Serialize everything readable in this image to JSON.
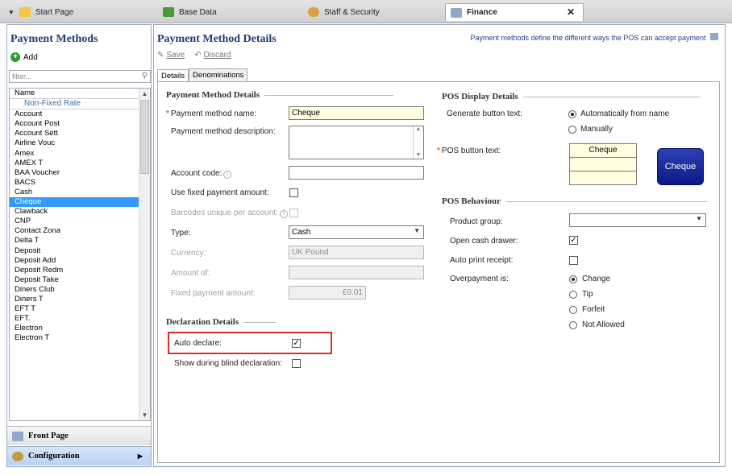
{
  "tabs": [
    {
      "label": "Start Page"
    },
    {
      "label": "Base Data"
    },
    {
      "label": "Staff & Security"
    },
    {
      "label": "Finance"
    }
  ],
  "left": {
    "title": "Payment Methods",
    "add_label": "Add",
    "filter_placeholder": "filter...",
    "list_header": "Name",
    "group_label": "Non-Fixed Rate",
    "items": [
      "Account",
      "Account Post",
      "Account Sett",
      "Airline Vouc",
      "Amex",
      "AMEX T",
      "BAA Voucher",
      "BACS",
      "Cash",
      "Cheque",
      "Clawback",
      "CNP",
      "Contact Zona",
      "Delta T",
      "Deposit",
      "Deposit Add",
      "Deposit Redm",
      "Deposit Take",
      "Diners Club",
      "Diners T",
      "EFT T",
      "EFT.",
      "Electron",
      "Electron T"
    ],
    "selected": "Cheque",
    "nav": [
      {
        "label": "Front Page"
      },
      {
        "label": "Configuration"
      }
    ]
  },
  "right": {
    "title": "Payment Method Details",
    "description": "Payment methods define the different ways the POS can accept payment",
    "save_label": "Save",
    "discard_label": "Discard",
    "form_tabs": [
      "Details",
      "Denominations"
    ],
    "pmd": {
      "section": "Payment Method Details",
      "name_label": "Payment method name:",
      "name_value": "Cheque",
      "desc_label": "Payment method description:",
      "account_label": "Account code:",
      "fixed_label": "Use fixed payment amount:",
      "barcode_label": "Barcodes unique per account:",
      "type_label": "Type:",
      "type_value": "Cash",
      "currency_label": "Currency:",
      "currency_value": "UK Pound",
      "amount_of_label": "Amount of:",
      "fixed_amount_label": "Fixed payment amount:",
      "fixed_amount_value": "£0.01"
    },
    "decl": {
      "section": "Declaration Details",
      "auto_label": "Auto declare:",
      "blind_label": "Show during blind declaration:"
    },
    "display": {
      "section": "POS Display Details",
      "gen_label": "Generate button text:",
      "opt_auto": "Automatically from name",
      "opt_manual": "Manually",
      "btn_text_label": "POS button text:",
      "btn_text_value": "Cheque",
      "preview_label": "Cheque"
    },
    "behaviour": {
      "section": "POS Behaviour",
      "product_label": "Product group:",
      "drawer_label": "Open cash drawer:",
      "receipt_label": "Auto print receipt:",
      "over_label": "Overpayment is:",
      "options": [
        "Change",
        "Tip",
        "Forfeit",
        "Not Allowed"
      ]
    }
  }
}
